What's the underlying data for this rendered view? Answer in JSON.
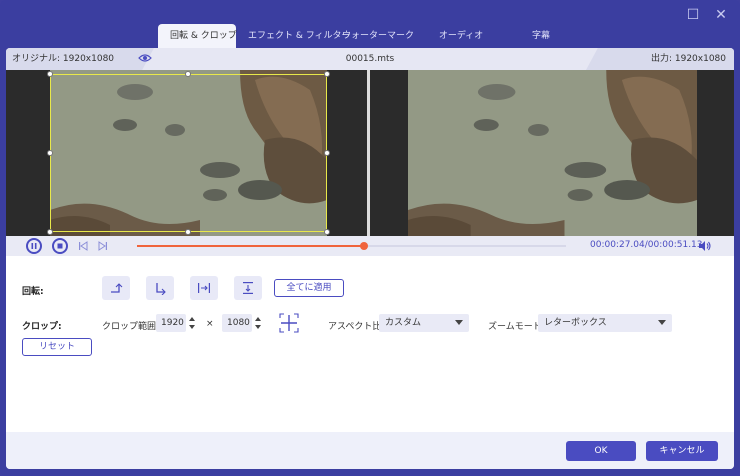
{
  "window": {
    "minimize_glyph": "☐",
    "close_glyph": "✕"
  },
  "tabs": [
    {
      "label": "回転 & クロップ",
      "active": true
    },
    {
      "label": "エフェクト & フィルター",
      "active": false
    },
    {
      "label": "ウォーターマーク",
      "active": false
    },
    {
      "label": "オーディオ",
      "active": false
    },
    {
      "label": "字幕",
      "active": false
    }
  ],
  "info": {
    "original": "オリジナル: 1920x1080",
    "filename": "00015.mts",
    "output": "出力: 1920x1080"
  },
  "playback": {
    "progress": 0.53,
    "current_time": "00:00:27.04",
    "total_time": "/00:00:51.13"
  },
  "rotate": {
    "label": "回転:",
    "apply_all": "全てに適用"
  },
  "crop": {
    "label": "クロップ:",
    "range_label": "クロップ範囲:",
    "width": "1920",
    "times": "×",
    "height": "1080",
    "aspect_label": "アスペクト比:",
    "aspect_value": "カスタム",
    "zoom_label": "ズームモード:",
    "zoom_value": "レターボックス",
    "reset": "リセット"
  },
  "footer": {
    "ok": "OK",
    "cancel": "キャンセル"
  },
  "colors": {
    "accent": "#4a4cc1",
    "window_bg": "#3b3ea0",
    "progress": "#f0643c",
    "crop_border": "#e8e84a"
  }
}
